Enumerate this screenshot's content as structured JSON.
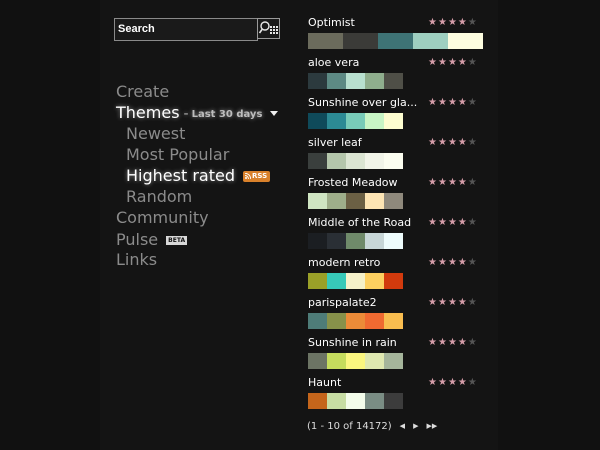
{
  "search": {
    "placeholder": "Search"
  },
  "nav": {
    "create": "Create",
    "themes": "Themes",
    "themes_dash": "-",
    "themes_range": "Last 30 days",
    "newest": "Newest",
    "most_popular": "Most Popular",
    "highest_rated": "Highest rated",
    "rss": "RSS",
    "random": "Random",
    "community": "Community",
    "pulse": "Pulse",
    "beta": "BETA",
    "links": "Links"
  },
  "themes": [
    {
      "name": "Optimist",
      "rating": 4,
      "swatches": [
        "#6b6b5c",
        "#3b3b38",
        "#3e7375",
        "#9ecfc0",
        "#fdfde0"
      ]
    },
    {
      "name": "aloe vera",
      "rating": 4,
      "swatches": [
        "#2c3a3e",
        "#5d8a84",
        "#b8e0cf",
        "#8fae8d",
        "#4f4f47"
      ]
    },
    {
      "name": "Sunshine over gla...",
      "rating": 4,
      "swatches": [
        "#0f4a5a",
        "#2c8a94",
        "#78cbb8",
        "#c8f5c5",
        "#fdfdd0"
      ]
    },
    {
      "name": "silver leaf",
      "rating": 4,
      "swatches": [
        "#3a3f3d",
        "#b4c6ab",
        "#dbe5d2",
        "#f1f4e8",
        "#fbfdf0"
      ]
    },
    {
      "name": "Frosted Meadow",
      "rating": 4,
      "swatches": [
        "#cfe5c2",
        "#9eae8a",
        "#6b6044",
        "#fde5b4",
        "#8f897c"
      ]
    },
    {
      "name": "Middle of the Road",
      "rating": 4,
      "swatches": [
        "#1b1e22",
        "#2a2f35",
        "#6f8a6a",
        "#c7d6d7",
        "#eefcfc"
      ]
    },
    {
      "name": "modern retro",
      "rating": 4,
      "swatches": [
        "#9aa028",
        "#37c9b8",
        "#f5f1c9",
        "#fdd060",
        "#d23a0d"
      ]
    },
    {
      "name": "parispalate2",
      "rating": 4,
      "swatches": [
        "#4e7c78",
        "#87914a",
        "#ec8b38",
        "#f06a31",
        "#f9bd4f"
      ]
    },
    {
      "name": "Sunshine in rain",
      "rating": 4,
      "swatches": [
        "#6c7464",
        "#c5dc5d",
        "#faf67f",
        "#dfe8b0",
        "#a5b59b"
      ]
    },
    {
      "name": "Haunt",
      "rating": 4,
      "swatches": [
        "#c4651b",
        "#c7dda3",
        "#f3fcea",
        "#7a8d84",
        "#3c3c3c"
      ]
    }
  ],
  "pager": {
    "text": "(1 - 10 of 14172)",
    "prev_icon": "prev-arrow-icon",
    "next_icon": "next-arrow-icon",
    "last_icon": "last-page-icon"
  },
  "colors": {
    "star_on": "#d49ca8",
    "star_off": "#555555",
    "rss": "#d9812b"
  }
}
